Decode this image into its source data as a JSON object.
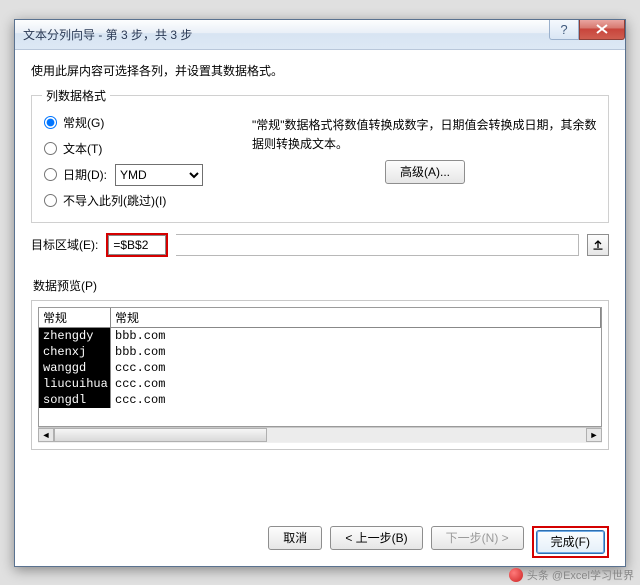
{
  "window": {
    "title": "文本分列向导 - 第 3 步，共 3 步"
  },
  "hint": "使用此屏内容可选择各列，并设置其数据格式。",
  "format_group": {
    "legend": "列数据格式",
    "options": {
      "general": "常规(G)",
      "text": "文本(T)",
      "date": "日期(D):",
      "skip": "不导入此列(跳过)(I)"
    },
    "date_select": {
      "value": "YMD"
    },
    "desc": "\"常规\"数据格式将数值转换成数字，日期值会转换成日期，其余数据则转换成文本。",
    "advanced": "高级(A)..."
  },
  "dest": {
    "label": "目标区域(E):",
    "value": "=$B$2"
  },
  "preview": {
    "legend": "数据预览(P)",
    "headers": [
      "常规",
      "常规"
    ],
    "rows": [
      [
        "zhengdy",
        "bbb.com"
      ],
      [
        "chenxj",
        "bbb.com"
      ],
      [
        "wanggd",
        "ccc.com"
      ],
      [
        "liucuihua",
        "ccc.com"
      ],
      [
        "songdl",
        "ccc.com"
      ]
    ]
  },
  "buttons": {
    "cancel": "取消",
    "back": "< 上一步(B)",
    "next": "下一步(N) >",
    "finish": "完成(F)"
  },
  "attribution": "头条 @Excel学习世界"
}
